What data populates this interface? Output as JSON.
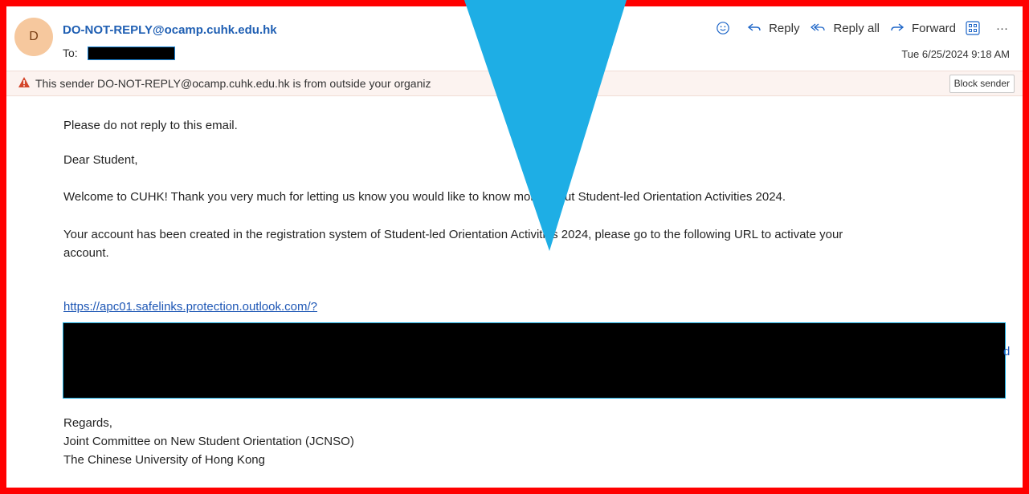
{
  "header": {
    "avatar_letter": "D",
    "sender": "DO-NOT-REPLY@ocamp.cuhk.edu.hk",
    "to_label": "To:",
    "date": "Tue 6/25/2024 9:18 AM",
    "actions": {
      "reply": "Reply",
      "reply_all": "Reply all",
      "forward": "Forward",
      "more": "···"
    }
  },
  "warning": {
    "text": "This sender DO-NOT-REPLY@ocamp.cuhk.edu.hk is from outside your organiz",
    "block_button": "Block sender"
  },
  "body": {
    "line1": "Please do not reply to this email.",
    "line2": "Dear Student,",
    "line3": "Welcome to CUHK! Thank you very much for letting us know you would like to know more about Student-led Orientation Activities 2024.",
    "line4a": "Your account has been created in the registration system of Student-led Orientation Activities 2024, please go to the following URL to activate your",
    "line4b": "account.",
    "link": "https://apc01.safelinks.protection.outlook.com/?",
    "regards": "Regards,",
    "sig1": "Joint Committee on New Student Orientation (JCNSO)",
    "sig2": "The Chinese University of Hong Kong"
  },
  "colors": {
    "frame": "#ff0000",
    "arrow": "#1eaee5",
    "link": "#1e57b5",
    "sender": "#1f5fb3",
    "avatar": "#f6c89e"
  }
}
